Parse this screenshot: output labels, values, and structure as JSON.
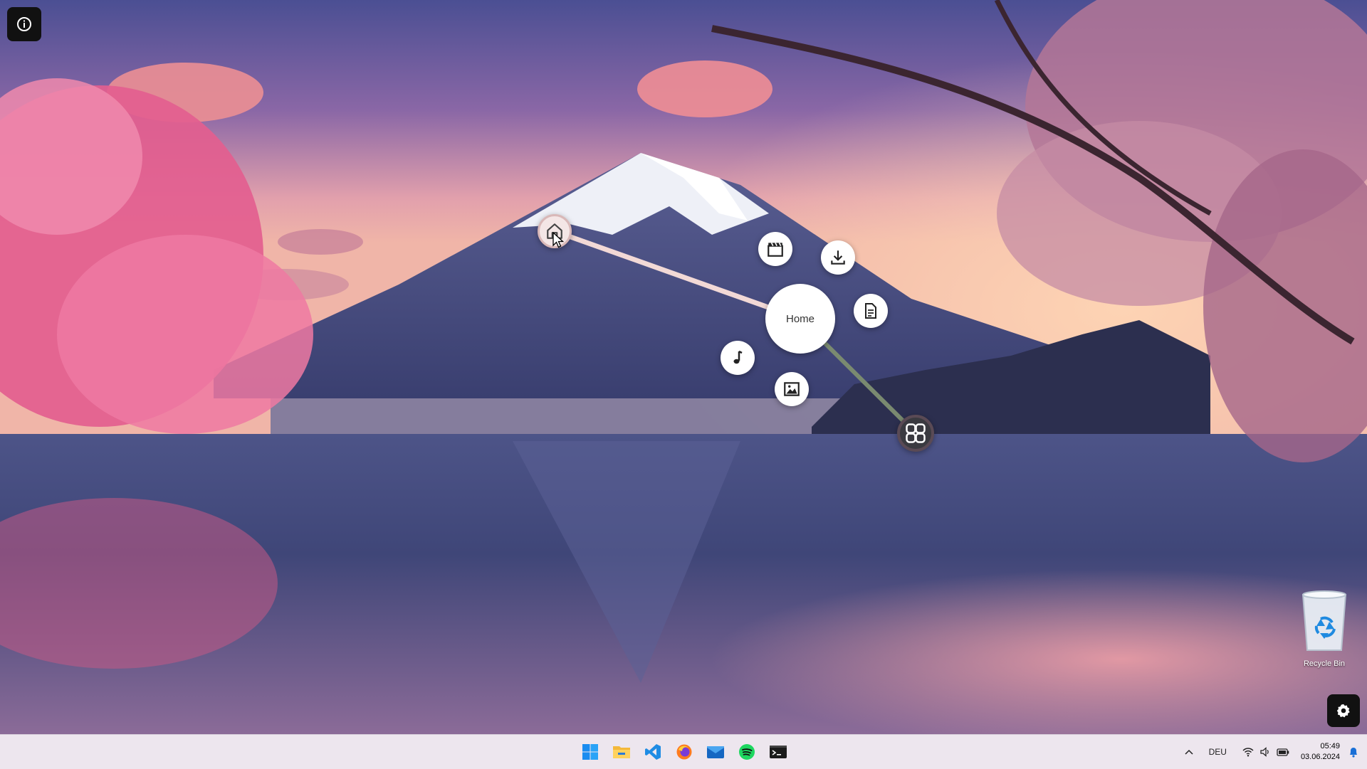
{
  "desktop": {
    "info_icon": "info-icon",
    "settings_icon": "gear-icon"
  },
  "radial_menu": {
    "center_label": "Home",
    "items": [
      {
        "icon": "home-icon",
        "state": "hovered"
      },
      {
        "icon": "movie-clapper-icon"
      },
      {
        "icon": "download-icon"
      },
      {
        "icon": "document-icon"
      },
      {
        "icon": "music-note-icon"
      },
      {
        "icon": "image-icon"
      },
      {
        "icon": "windows-start-icon"
      }
    ],
    "link_color_active": "#f2d9d6",
    "link_color_start": "#7a8a70"
  },
  "recycle_bin": {
    "label": "Recycle Bin"
  },
  "taskbar": {
    "apps": [
      {
        "name": "Start",
        "icon": "windows-start-icon"
      },
      {
        "name": "File Explorer",
        "icon": "folder-icon"
      },
      {
        "name": "Visual Studio Code",
        "icon": "vscode-icon"
      },
      {
        "name": "Firefox",
        "icon": "firefox-icon"
      },
      {
        "name": "Mail",
        "icon": "mail-icon"
      },
      {
        "name": "Spotify",
        "icon": "spotify-icon"
      },
      {
        "name": "Terminal",
        "icon": "terminal-icon"
      }
    ],
    "tray": {
      "chevron_icon": "chevron-up-icon",
      "language": "DEU",
      "wifi_icon": "wifi-icon",
      "volume_icon": "volume-icon",
      "battery_icon": "battery-icon",
      "time": "05:49",
      "date": "03.06.2024",
      "notification_icon": "bell-icon"
    }
  },
  "colors": {
    "taskbar_bg": "#ede6ee",
    "dark_button": "#111111"
  }
}
